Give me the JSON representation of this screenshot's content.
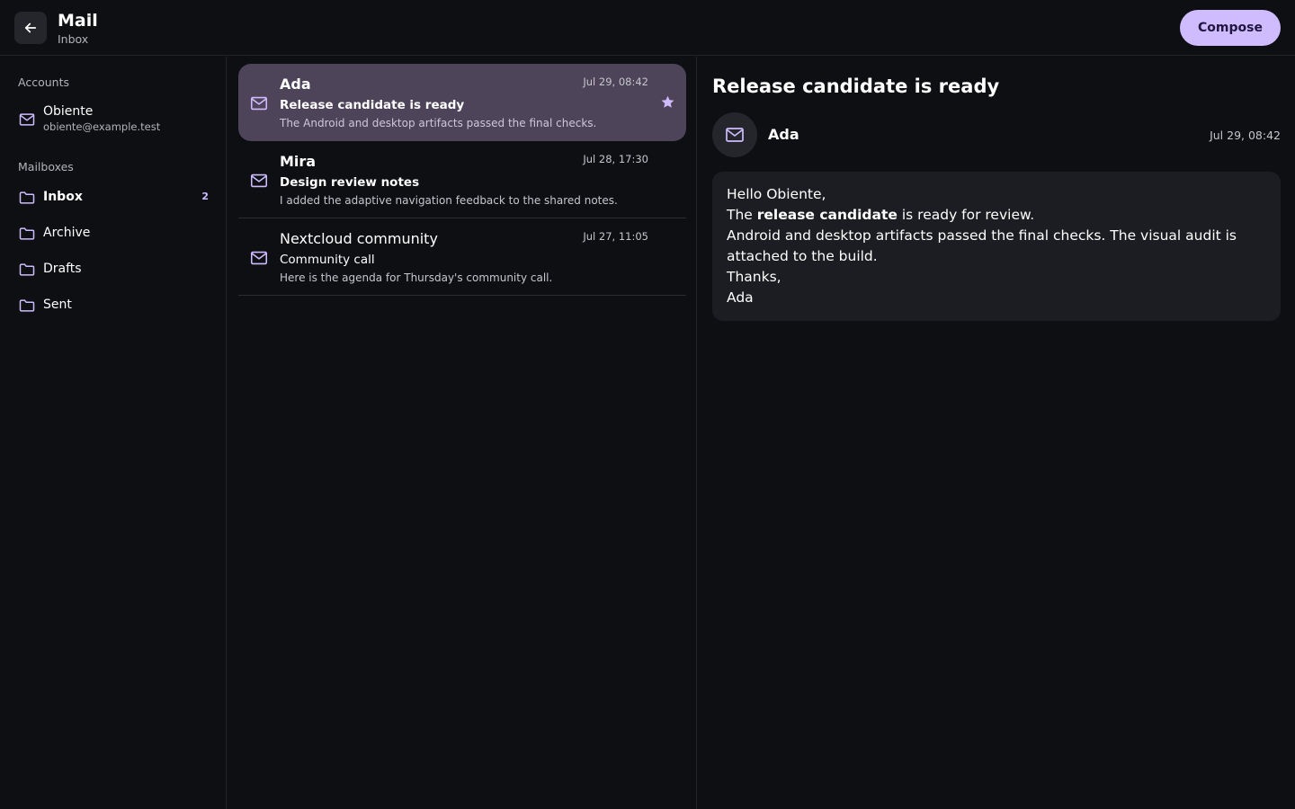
{
  "header": {
    "title": "Mail",
    "subtitle": "Inbox",
    "compose_label": "Compose"
  },
  "sidebar": {
    "accounts_label": "Accounts",
    "account": {
      "name": "Obiente",
      "email": "obiente@example.test"
    },
    "mailboxes_label": "Mailboxes",
    "mailboxes": [
      {
        "label": "Inbox",
        "count": "2",
        "active": true
      },
      {
        "label": "Archive",
        "count": ""
      },
      {
        "label": "Drafts",
        "count": ""
      },
      {
        "label": "Sent",
        "count": ""
      }
    ]
  },
  "messages": [
    {
      "sender": "Ada",
      "date": "Jul 29, 08:42",
      "subject": "Release candidate is ready",
      "preview": "The Android and desktop artifacts passed the final checks.",
      "selected": true,
      "starred": true
    },
    {
      "sender": "Mira",
      "date": "Jul 28, 17:30",
      "subject": "Design review notes",
      "preview": "I added the adaptive navigation feedback to the shared notes."
    },
    {
      "sender": "Nextcloud community",
      "date": "Jul 27, 11:05",
      "subject": "Community call",
      "preview": "Here is the agenda for Thursday's community call."
    }
  ],
  "reader": {
    "subject": "Release candidate is ready",
    "sender": "Ada",
    "date": "Jul 29, 08:42",
    "body": {
      "greeting": "Hello Obiente,",
      "line1_before": "The ",
      "line1_bold": "release candidate",
      "line1_after": " is ready for review.",
      "line2": "Android and desktop artifacts passed the final checks. The visual audit is attached to the build.",
      "closing": "Thanks,",
      "signature": "Ada"
    }
  },
  "colors": {
    "background": "#0e0f13",
    "accent": "#cfbcff",
    "selected_row": "#4e4459",
    "card": "#1c1d22"
  },
  "icons": {
    "back": "arrow-left-icon",
    "account": "mail-icon",
    "mailbox": "folder-icon",
    "message": "mail-icon",
    "star": "star-icon"
  }
}
